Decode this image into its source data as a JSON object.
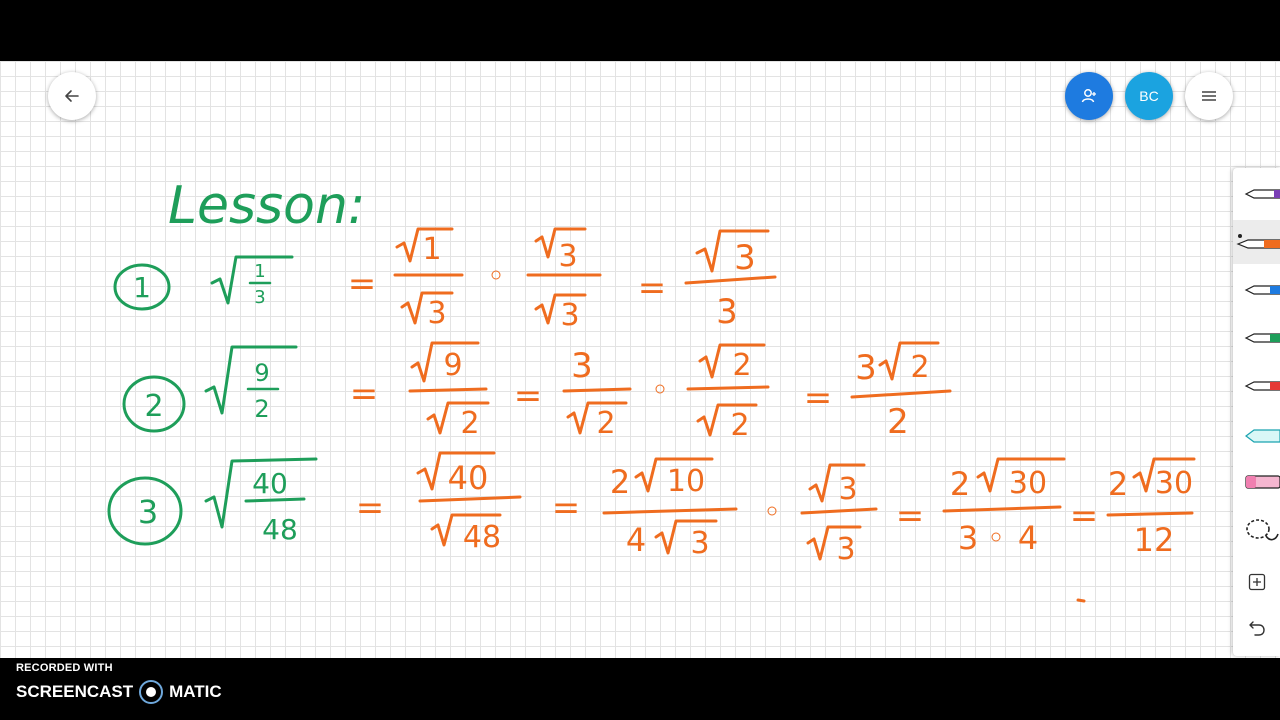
{
  "header": {
    "avatar_initials": "BC",
    "icons": [
      "back-arrow-icon",
      "add-person-icon",
      "hamburger-menu-icon"
    ]
  },
  "whiteboard": {
    "title": "Lesson:",
    "ink_colors": {
      "heading": "#1e9e5a",
      "work": "#ef6c1f"
    },
    "problems": [
      {
        "number": "1",
        "expression": "√(1/3)",
        "steps": [
          "√1/√3",
          "·",
          "√3/√3",
          "=",
          "√3/3"
        ]
      },
      {
        "number": "2",
        "expression": "√(9/2)",
        "steps": [
          "√9/√2",
          "=",
          "3/√2",
          "·",
          "√2/√2",
          "=",
          "3√2/2"
        ]
      },
      {
        "number": "3",
        "expression": "√(40/48)",
        "steps": [
          "√40/√48",
          "=",
          "2√10/4√3",
          "·",
          "√3/√3",
          "=",
          "2√30/3·4",
          "=",
          "2√30/12"
        ]
      }
    ]
  },
  "toolbar": {
    "tools": [
      "purple-pen-icon",
      "orange-pen-icon",
      "blue-pen-icon",
      "green-pen-icon",
      "red-pen-icon",
      "highlighter-icon",
      "eraser-icon",
      "lasso-icon",
      "add-icon",
      "undo-icon"
    ],
    "selected": "orange-pen-icon"
  },
  "watermark": {
    "recorded_with": "RECORDED WITH",
    "brand_left": "SCREENCAST",
    "brand_right": "MATIC"
  }
}
